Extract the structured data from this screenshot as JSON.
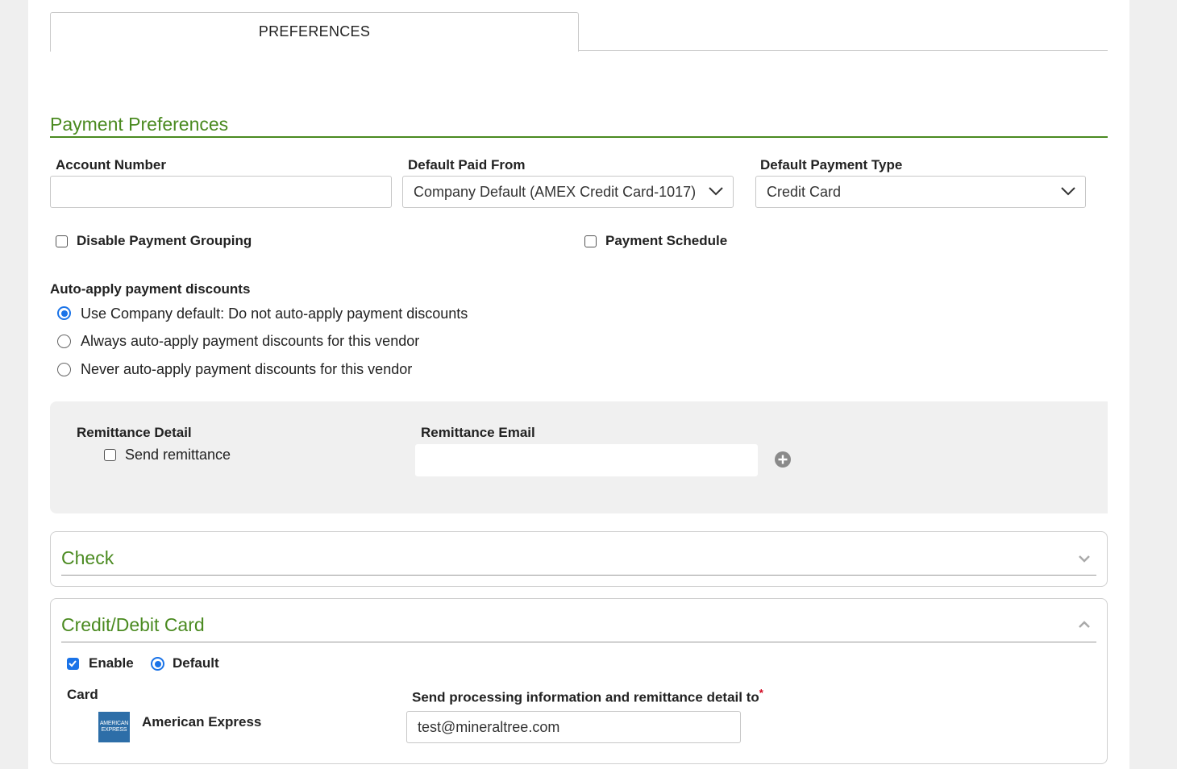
{
  "tabs": {
    "active_label": "PREFERENCES"
  },
  "payment_preferences": {
    "title": "Payment Preferences",
    "account_number": {
      "label": "Account Number",
      "value": ""
    },
    "default_paid_from": {
      "label": "Default Paid From",
      "value": "Company Default (AMEX Credit Card-1017)"
    },
    "default_payment_type": {
      "label": "Default Payment Type",
      "value": "Credit Card"
    },
    "disable_payment_grouping": {
      "label": "Disable Payment Grouping",
      "checked": false
    },
    "payment_schedule": {
      "label": "Payment Schedule",
      "checked": false
    },
    "auto_apply": {
      "label": "Auto-apply payment discounts",
      "options": [
        {
          "label": "Use Company default: Do not auto-apply payment discounts",
          "selected": true
        },
        {
          "label": "Always auto-apply payment discounts for this vendor",
          "selected": false
        },
        {
          "label": "Never auto-apply payment discounts for this vendor",
          "selected": false
        }
      ]
    }
  },
  "remittance": {
    "detail_label": "Remittance Detail",
    "send_remittance_label": "Send remittance",
    "send_remittance_checked": false,
    "email_label": "Remittance Email",
    "email_value": "",
    "add_icon": "plus-circle-icon"
  },
  "check_section": {
    "title": "Check",
    "expanded": false,
    "toggle_icon": "chevron-down-icon"
  },
  "card_section": {
    "title": "Credit/Debit Card",
    "expanded": true,
    "toggle_icon": "chevron-up-icon",
    "enable_label": "Enable",
    "enable_checked": true,
    "default_label": "Default",
    "default_selected": true,
    "card_label": "Card",
    "card_name": "American Express",
    "card_logo_text": "AMERICAN EXPRESS",
    "send_info_label": "Send processing information and remittance detail to",
    "required_mark": "*",
    "send_info_value": "test@mineraltree.com"
  },
  "colors": {
    "accent_green": "#4a8a20",
    "control_blue": "#1a73e8",
    "panel_grey": "#f0f0f0"
  }
}
